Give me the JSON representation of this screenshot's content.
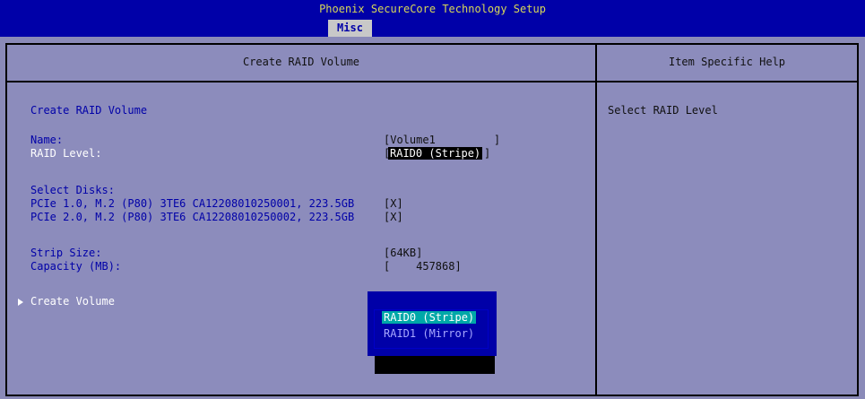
{
  "header": {
    "title": "Phoenix SecureCore Technology Setup",
    "active_tab": "Misc"
  },
  "main": {
    "column_header": "Create RAID Volume",
    "section_title": "Create RAID Volume",
    "name_label": "Name:",
    "name_value": "[Volume1         ]",
    "raid_level_label": "RAID Level:",
    "raid_level_value": "RAID0 (Stripe)",
    "select_disks_label": "Select Disks:",
    "disks": [
      {
        "label": "PCIe 1.0, M.2 (P80) 3TE6 CA12208010250001, 223.5GB",
        "value": "[X]"
      },
      {
        "label": "PCIe 2.0, M.2 (P80) 3TE6 CA12208010250002, 223.5GB",
        "value": "[X]"
      }
    ],
    "strip_size_label": "Strip Size:",
    "strip_size_value": "[64KB]",
    "capacity_label": "Capacity (MB):",
    "capacity_value": "[    457868]",
    "create_volume_label": "Create Volume"
  },
  "help": {
    "column_header": "Item Specific Help",
    "text": "Select RAID Level"
  },
  "popup": {
    "options": [
      "RAID0 (Stripe)",
      "RAID1 (Mirror)"
    ],
    "selected_index": 0
  },
  "colors": {
    "title_bg": "#0000a8",
    "title_fg": "#d8d858",
    "panel_bg": "#8c8cbc",
    "label_blue": "#0000a8",
    "highlight": "#00a8a8"
  },
  "icons": {
    "submenu": "triangle-right-icon"
  }
}
